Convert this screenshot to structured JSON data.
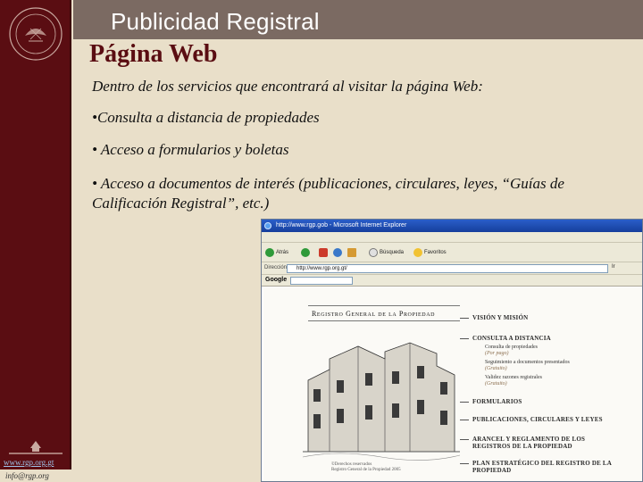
{
  "slide": {
    "section_title": "Publicidad Registral",
    "page_title": "Página Web",
    "intro": "Dentro de los servicios que encontrará al visitar la página Web:",
    "bullets": [
      "•Consulta a distancia de propiedades",
      "• Acceso a formularios y boletas",
      "• Acceso a documentos de interés (publicaciones, circulares, leyes, “Guías de Calificación Registral”, etc.)"
    ],
    "sidebar": {
      "url": "www.rgp.org.gt",
      "email": "info@rgp.org"
    }
  },
  "browser": {
    "window_title": "http://www.rgp.gob - Microsoft Internet Explorer",
    "toolbar": {
      "back": "Atrás",
      "search": "Búsqueda",
      "favorites": "Favoritos"
    },
    "address_label": "Dirección",
    "address_value": "http://www.rgp.org.gt/",
    "go_label": "Ir",
    "google_label": "Google",
    "site": {
      "header": "Registro General de la Propiedad",
      "copyright": [
        "©Derechos reservados",
        "Registro General de la Propiedad 2005"
      ],
      "menu": [
        "VISIÓN Y MISIÓN",
        "CONSULTA A DISTANCIA",
        "FORMULARIOS",
        "PUBLICACIONES, CIRCULARES Y LEYES",
        "ARANCEL Y REGLAMENTO DE LOS REGISTROS DE LA PROPIEDAD",
        "PLAN ESTRATÉGICO DEL REGISTRO DE LA PROPIEDAD"
      ],
      "submenu": [
        {
          "label": "Consulta de propiedades",
          "note": "(Por pago)"
        },
        {
          "label": "Seguimiento a documentos presentados",
          "note": "(Gratuito)"
        },
        {
          "label": "Validez razones registrales",
          "note": "(Gratuito)"
        }
      ]
    }
  },
  "colors": {
    "sidebar": "#5a0d12",
    "header_band": "#7b6a62",
    "background": "#e9dfc9",
    "title": "#5a0d12"
  }
}
